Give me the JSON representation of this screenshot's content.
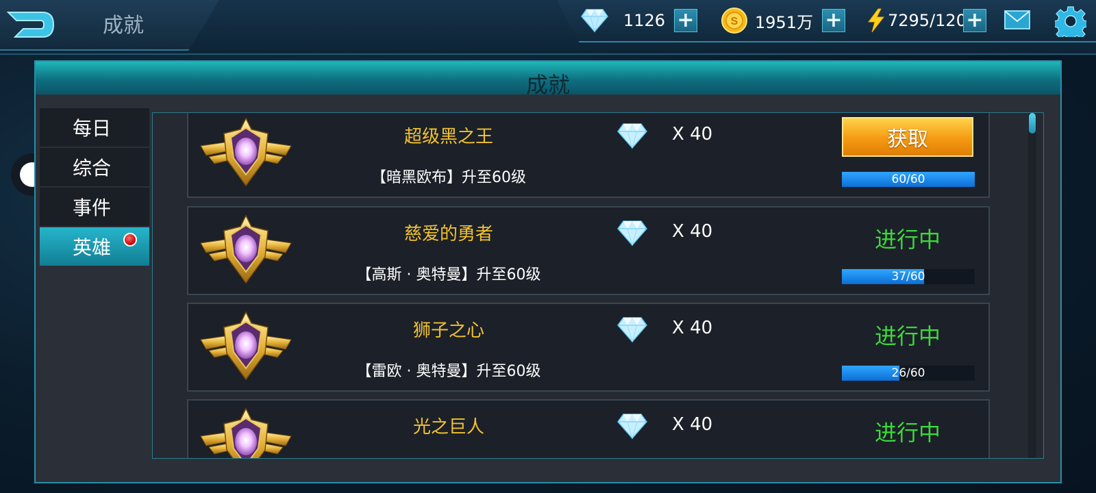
{
  "header": {
    "title": "成就",
    "diamonds": "1126",
    "coins": "1951万",
    "energy": "7295/120"
  },
  "panel": {
    "title": "成就"
  },
  "tabs": [
    {
      "label": "每日",
      "active": false,
      "dot": false
    },
    {
      "label": "综合",
      "active": false,
      "dot": false
    },
    {
      "label": "事件",
      "active": false,
      "dot": false
    },
    {
      "label": "英雄",
      "active": true,
      "dot": true
    }
  ],
  "achievements": [
    {
      "name": "超级黑之王",
      "desc": "【暗黑欧布】升至60级",
      "reward": "X 40",
      "state": "claim",
      "action": "获取",
      "progress_text": "60/60",
      "progress": 1.0
    },
    {
      "name": "慈爱的勇者",
      "desc": "【高斯 · 奥特曼】升至60级",
      "reward": "X 40",
      "state": "in_progress",
      "action": "进行中",
      "progress_text": "37/60",
      "progress": 0.617
    },
    {
      "name": "狮子之心",
      "desc": "【雷欧 · 奥特曼】升至60级",
      "reward": "X 40",
      "state": "in_progress",
      "action": "进行中",
      "progress_text": "26/60",
      "progress": 0.433
    },
    {
      "name": "光之巨人",
      "desc": "",
      "reward": "X 40",
      "state": "in_progress",
      "action": "进行中",
      "progress_text": "",
      "progress": null
    }
  ],
  "colors": {
    "accent": "#1fb6b8",
    "gold_text": "#f2c230",
    "in_progress": "#3bd93b",
    "claim": "#f59a12"
  }
}
